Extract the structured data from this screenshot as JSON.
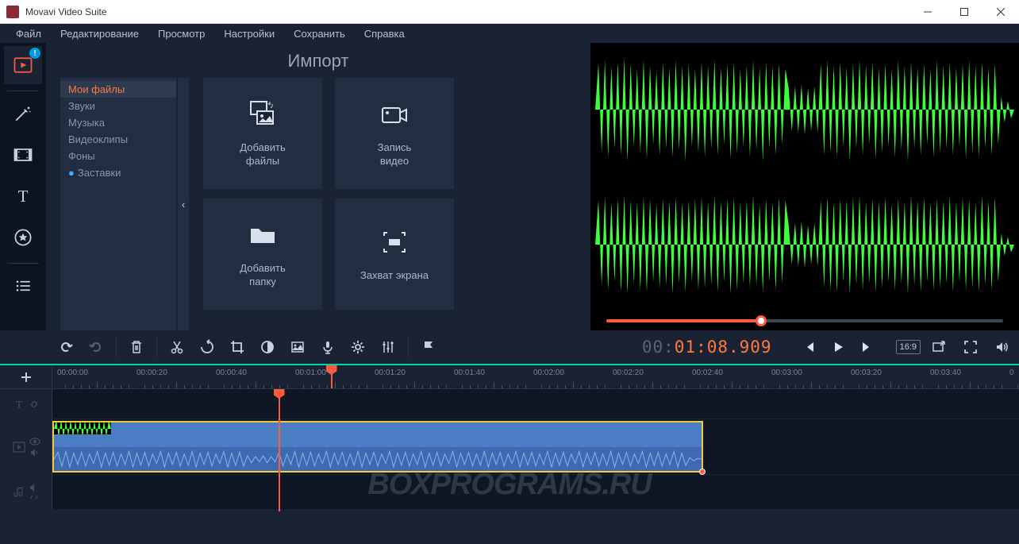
{
  "window": {
    "title": "Movavi Video Suite"
  },
  "menubar": [
    "Файл",
    "Редактирование",
    "Просмотр",
    "Настройки",
    "Сохранить",
    "Справка"
  ],
  "import": {
    "title": "Импорт",
    "categories": [
      {
        "label": "Мои файлы",
        "active": true
      },
      {
        "label": "Звуки"
      },
      {
        "label": "Музыка"
      },
      {
        "label": "Видеоклипы"
      },
      {
        "label": "Фоны"
      },
      {
        "label": "Заставки",
        "bullet": true
      }
    ],
    "tiles": {
      "add_files": "Добавить\nфайлы",
      "record_video": "Запись\nвидео",
      "add_folder": "Добавить\nпапку",
      "capture_screen": "Захват экрана"
    }
  },
  "playback": {
    "timecode_gray": "00:",
    "timecode_main": "01:08.909",
    "scrub_percent": 39,
    "aspect": "16:9"
  },
  "ruler": {
    "ticks": [
      "00:00:00",
      "00:00:20",
      "00:00:40",
      "00:01:00",
      "00:01:20",
      "00:01:40",
      "00:02:00",
      "00:02:20",
      "00:02:40",
      "00:03:00",
      "00:03:20",
      "00:03:40",
      "0"
    ]
  },
  "left_tools": {
    "import": "import",
    "effects": "effects",
    "transitions": "transitions",
    "titles": "titles",
    "stickers": "stickers",
    "more": "more"
  },
  "watermark": "BOXPROGRAMS.RU"
}
